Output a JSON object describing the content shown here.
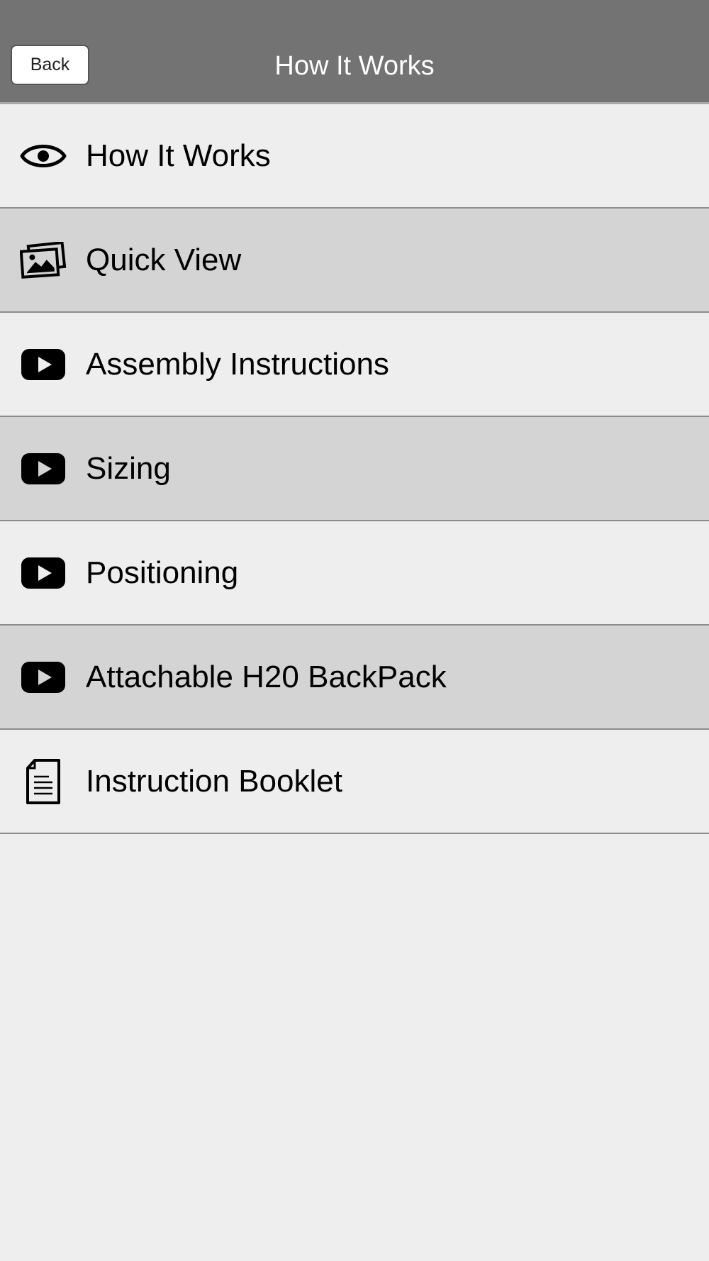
{
  "header": {
    "back_label": "Back",
    "title": "How It Works",
    "background_color": "#737373"
  },
  "menu": {
    "items": [
      {
        "label": "How It Works",
        "icon": "eye-icon"
      },
      {
        "label": "Quick View",
        "icon": "photos-icon"
      },
      {
        "label": "Assembly Instructions",
        "icon": "video-play-icon"
      },
      {
        "label": "Sizing",
        "icon": "video-play-icon"
      },
      {
        "label": "Positioning",
        "icon": "video-play-icon"
      },
      {
        "label": "Attachable H20 BackPack",
        "icon": "video-play-icon"
      },
      {
        "label": "Instruction Booklet",
        "icon": "document-icon"
      }
    ],
    "row_colors": [
      "#eeeeee",
      "#d4d4d4"
    ]
  }
}
